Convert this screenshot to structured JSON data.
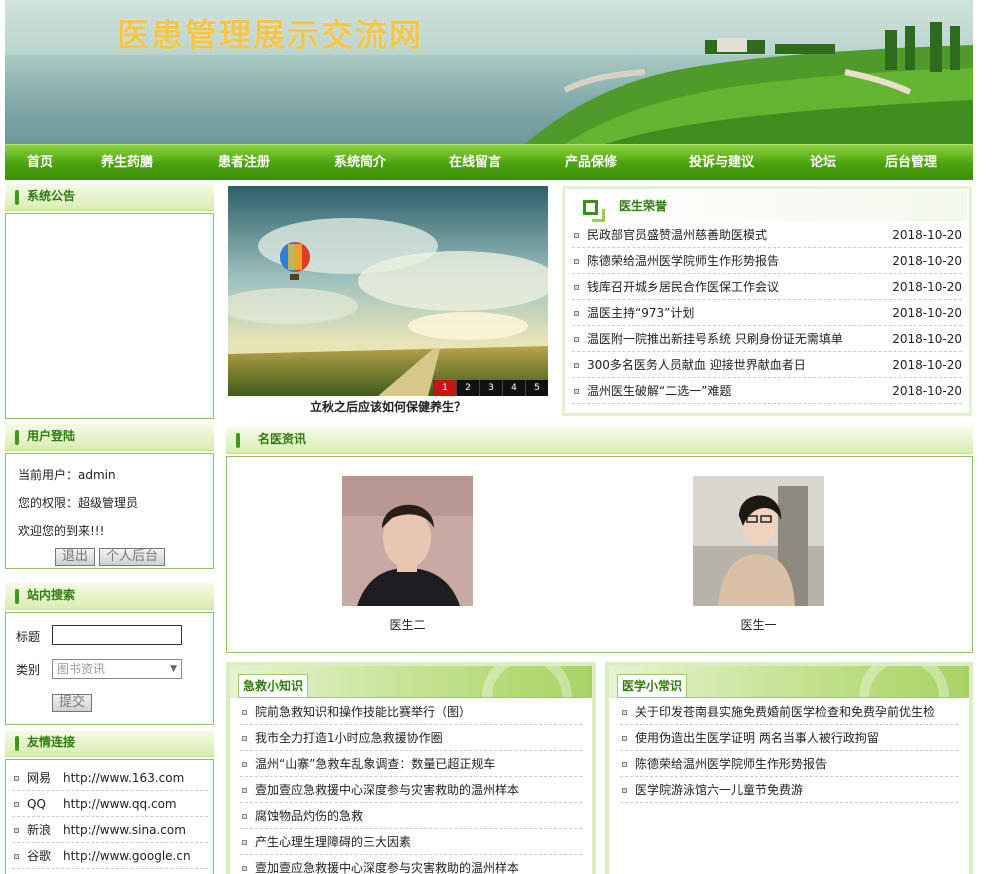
{
  "site": {
    "title": "医患管理展示交流网"
  },
  "nav": [
    "首页",
    "养生药膳",
    "患者注册",
    "系统简介",
    "在线留言",
    "产品保修",
    "投诉与建议",
    "论坛",
    "后台管理"
  ],
  "notice": {
    "title": "系统公告"
  },
  "login": {
    "title": "用户登陆",
    "current_user": "当前用户：admin",
    "role": "您的权限：超级管理员",
    "welcome": "欢迎您的到来!!!",
    "logout_label": "退出",
    "admin_label": "个人后台"
  },
  "search": {
    "title": "站内搜索",
    "title_label": "标题",
    "category_label": "类别",
    "category_value": "图书资讯",
    "submit_label": "提交"
  },
  "links": {
    "title": "友情连接",
    "items": [
      {
        "name": "网易",
        "url": "http://www.163.com"
      },
      {
        "name": "QQ",
        "url": "http://www.qq.com"
      },
      {
        "name": "新浪",
        "url": "http://www.sina.com"
      },
      {
        "name": "谷歌",
        "url": "http://www.google.cn"
      }
    ]
  },
  "slider": {
    "pages": [
      "1",
      "2",
      "3",
      "4",
      "5"
    ],
    "active": 0,
    "caption": "立秋之后应该如何保健养生？"
  },
  "honor": {
    "title": "医生荣誉",
    "items": [
      {
        "text": "民政部官员盛赞温州慈善助医模式",
        "date": "2018-10-20"
      },
      {
        "text": "陈德荣给温州医学院师生作形势报告",
        "date": "2018-10-20"
      },
      {
        "text": "钱库召开城乡居民合作医保工作会议",
        "date": "2018-10-20"
      },
      {
        "text": "温医主持“973”计划",
        "date": "2018-10-20"
      },
      {
        "text": "温医附一院推出新挂号系统 只刷身份证无需填单",
        "date": "2018-10-20"
      },
      {
        "text": "300多名医务人员献血 迎接世界献血者日",
        "date": "2018-10-20"
      },
      {
        "text": "温州医生破解“二选一”难题",
        "date": "2018-10-20"
      }
    ]
  },
  "doctors": {
    "title": "名医资讯",
    "items": [
      {
        "name": "医生二"
      },
      {
        "name": "医生一"
      }
    ]
  },
  "firstaid": {
    "title": "急救小知识",
    "items": [
      "院前急救知识和操作技能比赛举行（图）",
      "我市全力打造1小时应急救援协作圈",
      "温州“山寨”急救车乱象调查：数量已超正规车",
      "壹加壹应急救援中心深度参与灾害救助的温州样本",
      "腐蚀物品灼伤的急救",
      "产生心理生理障碍的三大因素",
      "壹加壹应急救援中心深度参与灾害救助的温州样本"
    ]
  },
  "medknow": {
    "title": "医学小常识",
    "items": [
      "关于印发苍南县实施免费婚前医学检查和免费孕前优生检",
      "使用伪造出生医学证明 两名当事人被行政拘留",
      "陈德荣给温州医学院师生作形势报告",
      "医学院游泳馆六一儿童节免费游"
    ]
  }
}
